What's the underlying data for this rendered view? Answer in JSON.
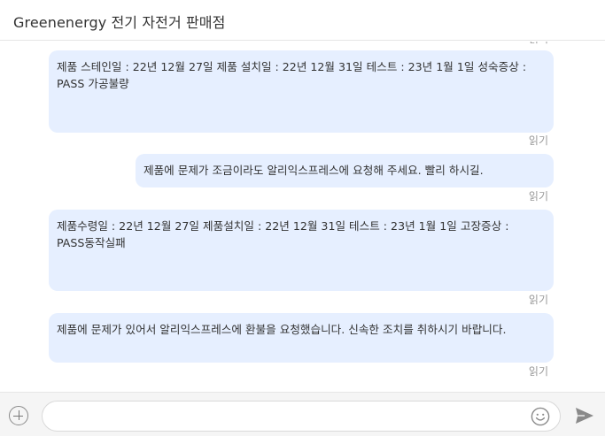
{
  "header": {
    "title": "Greenenergy 전기 자전거 판매점"
  },
  "messages": [
    {
      "text": "제품 스테인일 : 22년 12월 27일 제품 설치일 : 22년 12월 31일 테스트 : 23년 1월 1일 성숙증상 : PASS 가공불량",
      "status": "읽기"
    },
    {
      "text": "제품에 문제가 조금이라도 알리익스프레스에 요청해 주세요. 빨리 하시길.",
      "status": "읽기"
    },
    {
      "text": "제품수령일 : 22년 12월 27일 제품설치일 : 22년 12월 31일 테스트 : 23년 1월 1일 고장증상 : PASS동작실패",
      "status": "읽기"
    },
    {
      "text": "제품에 문제가 있어서 알리익스프레스에 환불을 요청했습니다. 신속한 조치를 취하시기 바랍니다.",
      "status": "읽기"
    }
  ],
  "top_status": "읽기",
  "input": {
    "value": "",
    "placeholder": ""
  },
  "icons": {
    "add": "plus-circle-icon",
    "emoji": "smiley-icon",
    "send": "paper-plane-icon"
  },
  "colors": {
    "bubble": "#e6efff",
    "status_text": "#999999",
    "input_bar": "#f5f5f5"
  }
}
